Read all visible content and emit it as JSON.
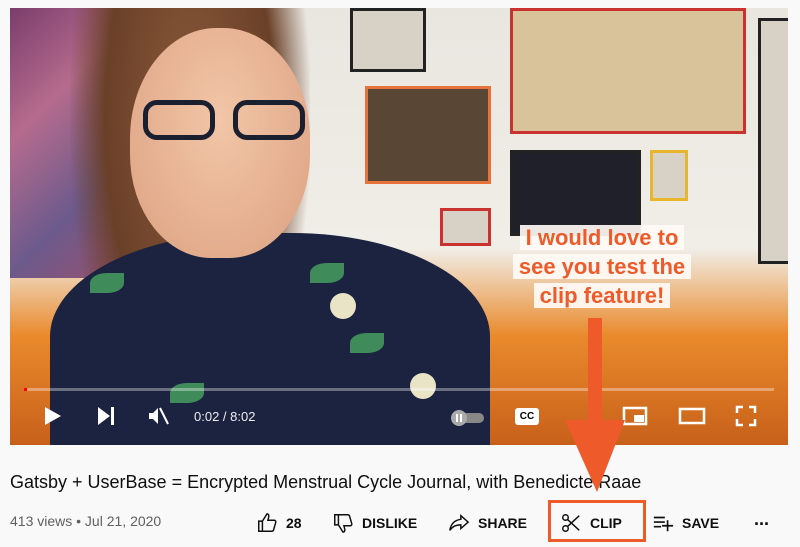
{
  "player": {
    "current_time": "0:02",
    "duration": "8:02",
    "time_display": "0:02 / 8:02",
    "progress_fraction": 0.004,
    "muted": true,
    "autoplay": "off",
    "cc_label": "CC"
  },
  "annotation": {
    "lines": [
      "I would love to",
      "see you test the",
      "clip feature!"
    ],
    "color": "#ee5a29"
  },
  "video": {
    "title": "Gatsby + UserBase = Encrypted Menstrual Cycle Journal, with Benedicte Raae",
    "meta": "413 views • Jul 21, 2020"
  },
  "actions": {
    "like_count": "28",
    "dislike_label": "DISLIKE",
    "share_label": "SHARE",
    "clip_label": "CLIP",
    "save_label": "SAVE",
    "more_label": "..."
  },
  "colors": {
    "highlight": "#ee5a29",
    "progress": "#ff0000"
  }
}
